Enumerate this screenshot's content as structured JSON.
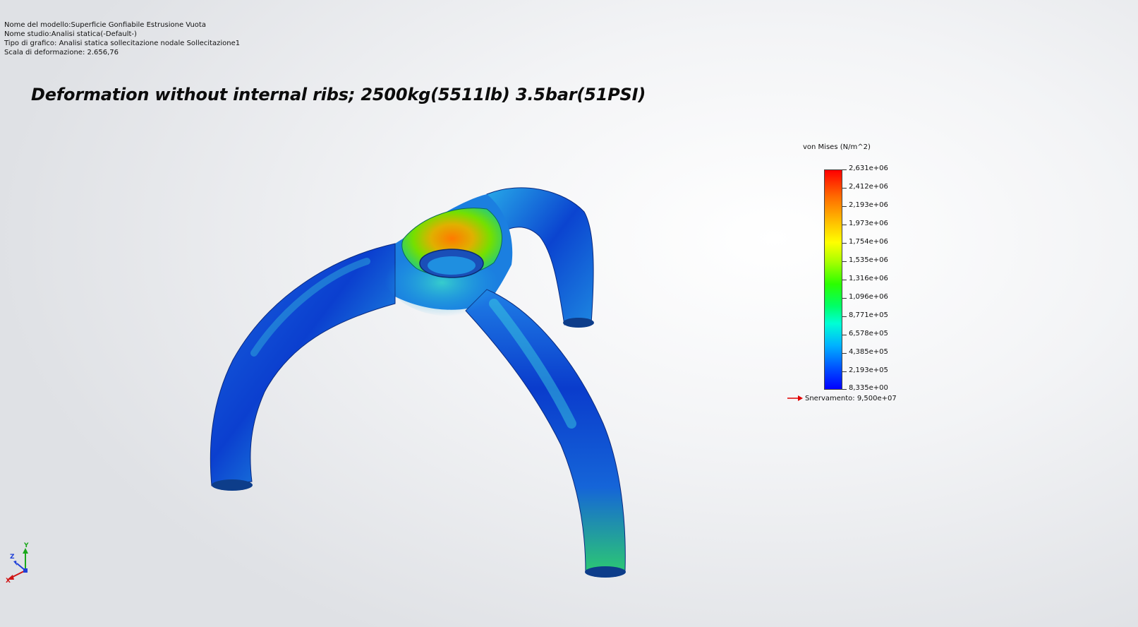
{
  "study_info": {
    "model_name": "Nome del modello:Superficie Gonfiabile Estrusione Vuota",
    "study_name": "Nome studio:Analisi statica(-Default-)",
    "plot_type": "Tipo di grafico: Analisi statica sollecitazione nodale Sollecitazione1",
    "deformation_scale": "Scala di deformazione: 2.656,76"
  },
  "annotation": {
    "title": "Deformation without internal ribs; 2500kg(5511lb) 3.5bar(51PSI)"
  },
  "legend": {
    "title": "von Mises (N/m^2)",
    "ticks": [
      "2,631e+06",
      "2,412e+06",
      "2,193e+06",
      "1,973e+06",
      "1,754e+06",
      "1,535e+06",
      "1,316e+06",
      "1,096e+06",
      "8,771e+05",
      "6,578e+05",
      "4,385e+05",
      "2,193e+05",
      "8,335e+00"
    ],
    "yield_label": "Snervamento: 9,500e+07",
    "colors": {
      "max": "#ff0000",
      "mid": "#2bff00",
      "min": "#0000ff",
      "yield_arrow": "#e00000"
    }
  },
  "triad": {
    "x_label": "X",
    "y_label": "Y",
    "z_label": "Z"
  }
}
